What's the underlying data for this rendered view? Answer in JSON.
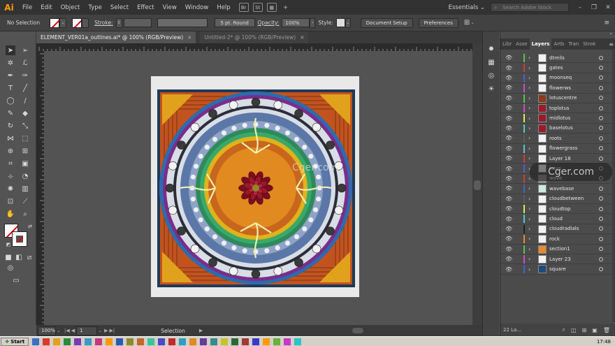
{
  "app": {
    "logo": "Ai",
    "accent": "#FF9A00"
  },
  "menu": [
    "File",
    "Edit",
    "Object",
    "Type",
    "Select",
    "Effect",
    "View",
    "Window",
    "Help"
  ],
  "menu_chips": [
    "Br",
    "St"
  ],
  "workspace": "Essentials",
  "stock_search_placeholder": "Search Adobe Stock",
  "control": {
    "selection_label": "No Selection",
    "stroke_label": "Stroke:",
    "brush_value": "5 pt. Round",
    "opacity_label": "Opacity:",
    "opacity_value": "100%",
    "style_label": "Style:",
    "document_setup": "Document Setup",
    "preferences": "Preferences"
  },
  "tabs": [
    {
      "label": "ELEMENT_VER01a_outlines.ai* @ 100% (RGB/Preview)",
      "close": "×"
    },
    {
      "label": "Untitled-2* @ 100% (RGB/Preview)",
      "close": "×"
    }
  ],
  "status": {
    "zoom": "100%",
    "page": "1",
    "mode": "Selection"
  },
  "panel_tabs": [
    "Libr",
    "Asse",
    "Layers",
    "Artb",
    "Tran",
    "Strok"
  ],
  "layers": [
    {
      "name": "dtreils",
      "color": "#4ec94e",
      "thumb": "#f2f2f2"
    },
    {
      "name": "gates",
      "color": "#d43a3a",
      "thumb": "#f2f2f2"
    },
    {
      "name": "moonseq",
      "color": "#4a5fcf",
      "thumb": "#f2f2f2"
    },
    {
      "name": "flowerws",
      "color": "#c94ec9",
      "thumb": "#f2f2f2"
    },
    {
      "name": "lotuscentre",
      "color": "#4ec94e",
      "thumb": "#8a3b1e"
    },
    {
      "name": "toplotus",
      "color": "#c94ec9",
      "thumb": "#9a1a2a"
    },
    {
      "name": "midlotus",
      "color": "#e6e64e",
      "thumb": "#9a1a2a"
    },
    {
      "name": "baselotus",
      "color": "#4ec9c9",
      "thumb": "#9a1a2a"
    },
    {
      "name": "roots",
      "color": "#5a5a5a",
      "thumb": "#f2f2f2"
    },
    {
      "name": "flowergrass",
      "color": "#4ec9c9",
      "thumb": "#f2f2f2"
    },
    {
      "name": "Layer 18",
      "color": "#d43a3a",
      "thumb": "#f2f2f2"
    },
    {
      "name": "lotus",
      "color": "#4a5fcf",
      "thumb": "#f2f2f2"
    },
    {
      "name": "wave",
      "color": "#d43a3a",
      "thumb": "#8a8a8a"
    },
    {
      "name": "wavebase",
      "color": "#4a5fcf",
      "thumb": "#cfe8e0"
    },
    {
      "name": "cloudbetween",
      "color": "#5a5a5a",
      "thumb": "#f2f2f2"
    },
    {
      "name": "cloudtop",
      "color": "#e6e64e",
      "thumb": "#f2f2f2"
    },
    {
      "name": "cloud",
      "color": "#4ec9c9",
      "thumb": "#f2f2f2"
    },
    {
      "name": "cloudradials",
      "color": "#222222",
      "thumb": "#f2f2f2"
    },
    {
      "name": "rock",
      "color": "#e68a2e",
      "thumb": "#f2f2f2"
    },
    {
      "name": "section1",
      "color": "#4ec94e",
      "thumb": "#e68a2e"
    },
    {
      "name": "Layer 23",
      "color": "#c94ec9",
      "thumb": "#f2f2f2"
    },
    {
      "name": "square",
      "color": "#4a5fcf",
      "thumb": "#1e4a7a"
    }
  ],
  "layers_count": "22 La...",
  "watermark": "Cger.com",
  "taskbar": {
    "start": "Start",
    "clock": "17:48"
  }
}
